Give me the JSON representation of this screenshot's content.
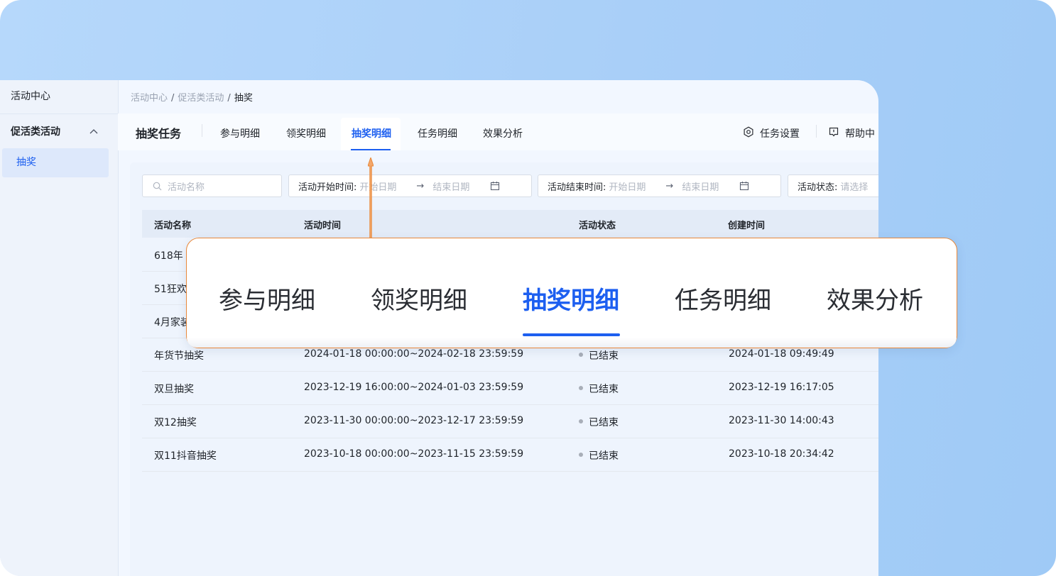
{
  "sidebar": {
    "title": "活动中心",
    "group": "促活类活动",
    "item": "抽奖"
  },
  "breadcrumb": [
    "活动中心",
    "促活类活动",
    "抽奖"
  ],
  "header": {
    "title": "抽奖任务",
    "tabs": [
      "参与明细",
      "领奖明细",
      "抽奖明细",
      "任务明细",
      "效果分析"
    ],
    "active_tab": "抽奖明细",
    "task_settings": "任务设置",
    "help": "帮助中"
  },
  "filters": {
    "search_placeholder": "活动名称",
    "start_label": "活动开始时间:",
    "start_from": "开始日期",
    "start_to": "结束日期",
    "end_label": "活动结束时间:",
    "end_from": "开始日期",
    "end_to": "结束日期",
    "status_label": "活动状态:",
    "status_placeholder": "请选择"
  },
  "table": {
    "columns": [
      "活动名称",
      "活动时间",
      "活动状态",
      "创建时间"
    ],
    "rows": [
      {
        "name": "618年",
        "time": "",
        "status": "",
        "created": ""
      },
      {
        "name": "51狂欢",
        "time": "",
        "status": "",
        "created": ""
      },
      {
        "name": "4月家装",
        "time": "",
        "status": "",
        "created": ""
      },
      {
        "name": "年货节抽奖",
        "time": "2024-01-18 00:00:00~2024-02-18 23:59:59",
        "status": "已结束",
        "created": "2024-01-18 09:49:49"
      },
      {
        "name": "双旦抽奖",
        "time": "2023-12-19 16:00:00~2024-01-03 23:59:59",
        "status": "已结束",
        "created": "2023-12-19 16:17:05"
      },
      {
        "name": "双12抽奖",
        "time": "2023-11-30 00:00:00~2023-12-17 23:59:59",
        "status": "已结束",
        "created": "2023-11-30 14:00:43"
      },
      {
        "name": "双11抖音抽奖",
        "time": "2023-10-18 00:00:00~2023-11-15 23:59:59",
        "status": "已结束",
        "created": "2023-10-18 20:34:42"
      }
    ]
  },
  "zoom": {
    "tabs": [
      "参与明细",
      "领奖明细",
      "抽奖明细",
      "任务明细",
      "效果分析"
    ],
    "active": "抽奖明细"
  },
  "colors": {
    "accent": "#1d5ff0",
    "callout": "#e8883a",
    "background": "#a9cff8"
  },
  "icons": {
    "chevron": "chevron-up-icon",
    "search": "search-icon",
    "calendar": "calendar-icon",
    "settings": "settings-icon",
    "help": "help-icon"
  }
}
